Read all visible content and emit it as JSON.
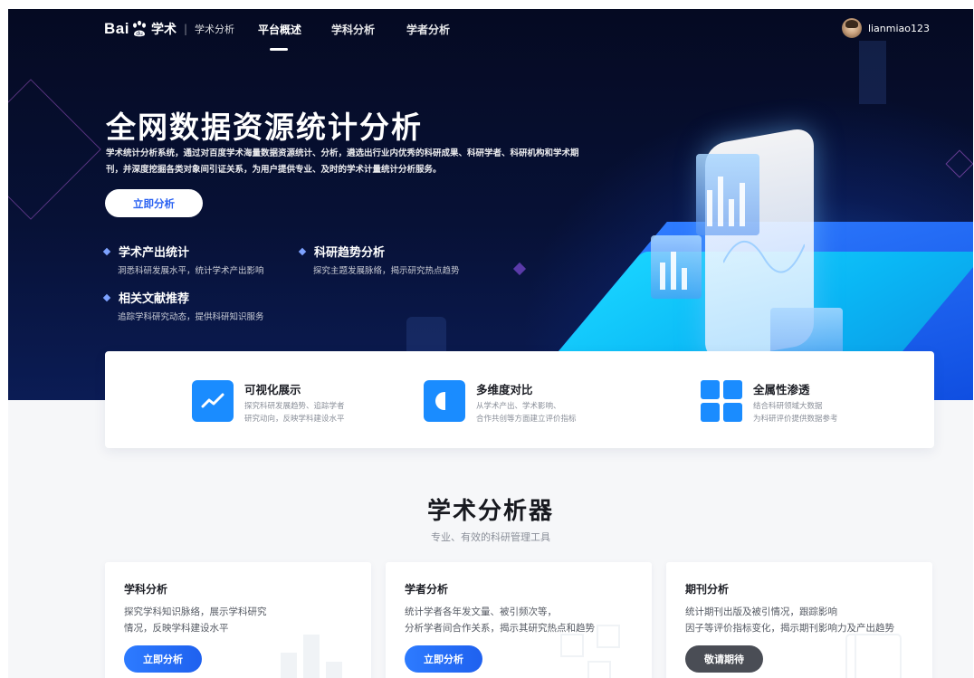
{
  "nav": {
    "logo_text": "Bai",
    "logo_product": "学术",
    "logo_section": "学术分析",
    "items": [
      {
        "label": "平台概述",
        "active": true
      },
      {
        "label": "学科分析",
        "active": false
      },
      {
        "label": "学者分析",
        "active": false
      }
    ],
    "username": "lianmiao123"
  },
  "hero": {
    "title": "全网数据资源统计分析",
    "description": "学术统计分析系统，通过对百度学术海量数据资源统计、分析，遴选出行业内优秀的科研成果、科研学者、科研机构和学术期刊，并深度挖掘各类对象间引证关系，为用户提供专业、及时的学术计量统计分析服务。",
    "cta_label": "立即分析",
    "features": [
      {
        "title": "学术产出统计",
        "desc": "洞悉科研发展水平，统计学术产出影响"
      },
      {
        "title": "科研趋势分析",
        "desc": "探究主题发展脉络，揭示研究热点趋势"
      },
      {
        "title": "相关文献推荐",
        "desc": "追踪学科研究动态，提供科研知识服务"
      }
    ]
  },
  "highlights": [
    {
      "title": "可视化展示",
      "desc1": "探究科研发展趋势、追踪学者",
      "desc2": "研究动向，反映学科建设水平",
      "icon": "line-chart-icon"
    },
    {
      "title": "多维度对比",
      "desc1": "从学术产出、学术影响、",
      "desc2": "合作共创等方面建立评价指标",
      "icon": "half-circle-icon"
    },
    {
      "title": "全属性渗透",
      "desc1": "结合科研领域大数据",
      "desc2": "为科研评价提供数据参考",
      "icon": "grid-icon"
    }
  ],
  "section": {
    "title": "学术分析器",
    "subtitle": "专业、有效的科研管理工具"
  },
  "cards": [
    {
      "title": "学科分析",
      "desc1": "探究学科知识脉络，展示学科研究",
      "desc2": "情况，反映学科建设水平",
      "button": "立即分析"
    },
    {
      "title": "学者分析",
      "desc1": "统计学者各年发文量、被引频次等，",
      "desc2": "分析学者间合作关系，揭示其研究热点和趋势",
      "button": "立即分析"
    },
    {
      "title": "期刊分析",
      "desc1": "统计期刊出版及被引情况，跟踪影响",
      "desc2": "因子等评价指标变化，揭示期刊影响力及产出趋势",
      "button": "敬请期待"
    }
  ],
  "colors": {
    "primary": "#1a8cff",
    "hero_bg": "#050a22",
    "disabled_button": "#4a4d55"
  }
}
